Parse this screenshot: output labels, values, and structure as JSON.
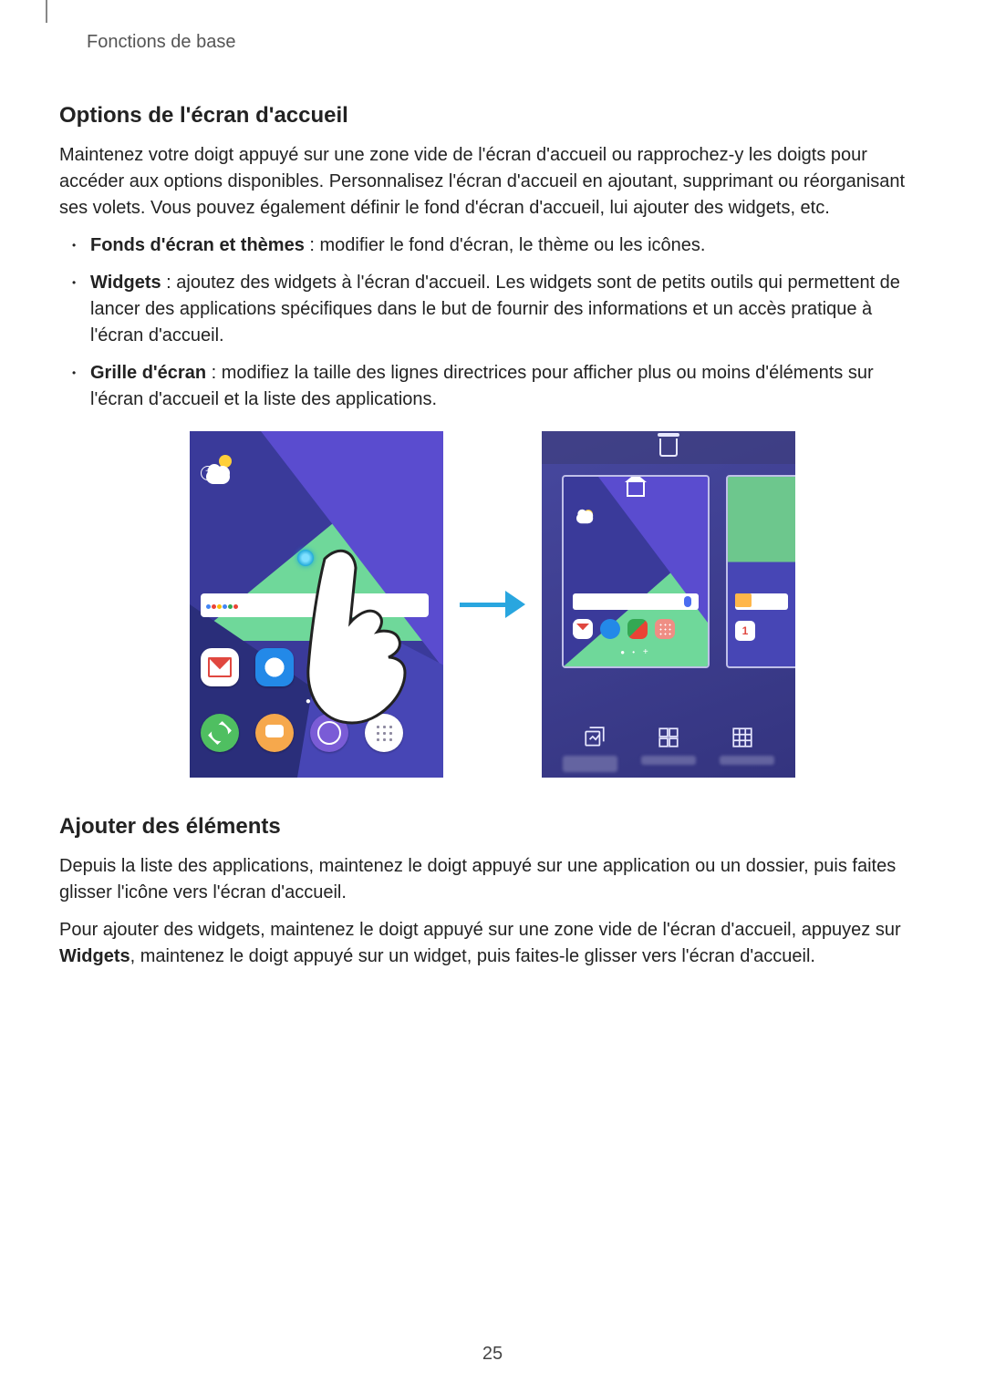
{
  "breadcrumb": "Fonctions de base",
  "section1": {
    "title": "Options de l'écran d'accueil",
    "intro": "Maintenez votre doigt appuyé sur une zone vide de l'écran d'accueil ou rapprochez-y les doigts pour accéder aux options disponibles. Personnalisez l'écran d'accueil en ajoutant, supprimant ou réorganisant ses volets. Vous pouvez également définir le fond d'écran d'accueil, lui ajouter des widgets, etc.",
    "bullets": [
      {
        "bold": "Fonds d'écran et thèmes",
        "rest": " : modifier le fond d'écran, le thème ou les icônes."
      },
      {
        "bold": "Widgets",
        "rest": " : ajoutez des widgets à l'écran d'accueil. Les widgets sont de petits outils qui permettent de lancer des applications spécifiques dans le but de fournir des informations et un accès pratique à l'écran d'accueil."
      },
      {
        "bold": "Grille d'écran",
        "rest": " : modifiez la taille des lignes directrices pour afficher plus ou moins d'éléments sur l'écran d'accueil et la liste des applications."
      }
    ]
  },
  "section2": {
    "title": "Ajouter des éléments",
    "p1": "Depuis la liste des applications, maintenez le doigt appuyé sur une application ou un dossier, puis faites glisser l'icône vers l'écran d'accueil.",
    "p2_pre": "Pour ajouter des widgets, maintenez le doigt appuyé sur une zone vide de l'écran d'accueil, appuyez sur ",
    "p2_bold": "Widgets",
    "p2_post": ", maintenez le doigt appuyé sur un widget, puis faites-le glisser vers l'écran d'accueil."
  },
  "figure": {
    "side_calendar_day": "1"
  },
  "page_number": "25"
}
